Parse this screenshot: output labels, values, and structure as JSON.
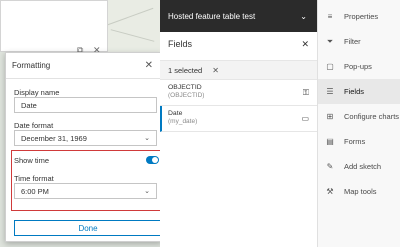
{
  "popup_card": {
    "icon1": "⧉",
    "icon2": "✕"
  },
  "formatting": {
    "title": "Formatting",
    "close_glyph": "✕",
    "display_name_label": "Display name",
    "display_name_value": "Date",
    "date_format_label": "Date format",
    "date_format_value": "December 31, 1969",
    "show_time_label": "Show time",
    "time_format_label": "Time format",
    "time_format_value": "6:00 PM",
    "done_label": "Done"
  },
  "fields_panel": {
    "layer_title": "Hosted feature table test",
    "heading": "Fields",
    "selected_text": "1 selected",
    "rows": [
      {
        "name": "OBJECTID",
        "alias": "(OBJECTID)"
      },
      {
        "name": "Date",
        "alias": "(my_date)"
      }
    ]
  },
  "sidebar": {
    "items": [
      {
        "label": "Properties",
        "icon": "≡"
      },
      {
        "label": "Filter",
        "icon": "⏷"
      },
      {
        "label": "Pop-ups",
        "icon": "▢"
      },
      {
        "label": "Fields",
        "icon": "☰"
      },
      {
        "label": "Configure charts",
        "icon": "⊞"
      },
      {
        "label": "Forms",
        "icon": "▤"
      },
      {
        "label": "Add sketch",
        "icon": "✎"
      },
      {
        "label": "Map tools",
        "icon": "⚒"
      }
    ]
  },
  "colors": {
    "accent": "#007ac2",
    "highlight": "#d03a3a",
    "topbar": "#2b2b2b"
  }
}
